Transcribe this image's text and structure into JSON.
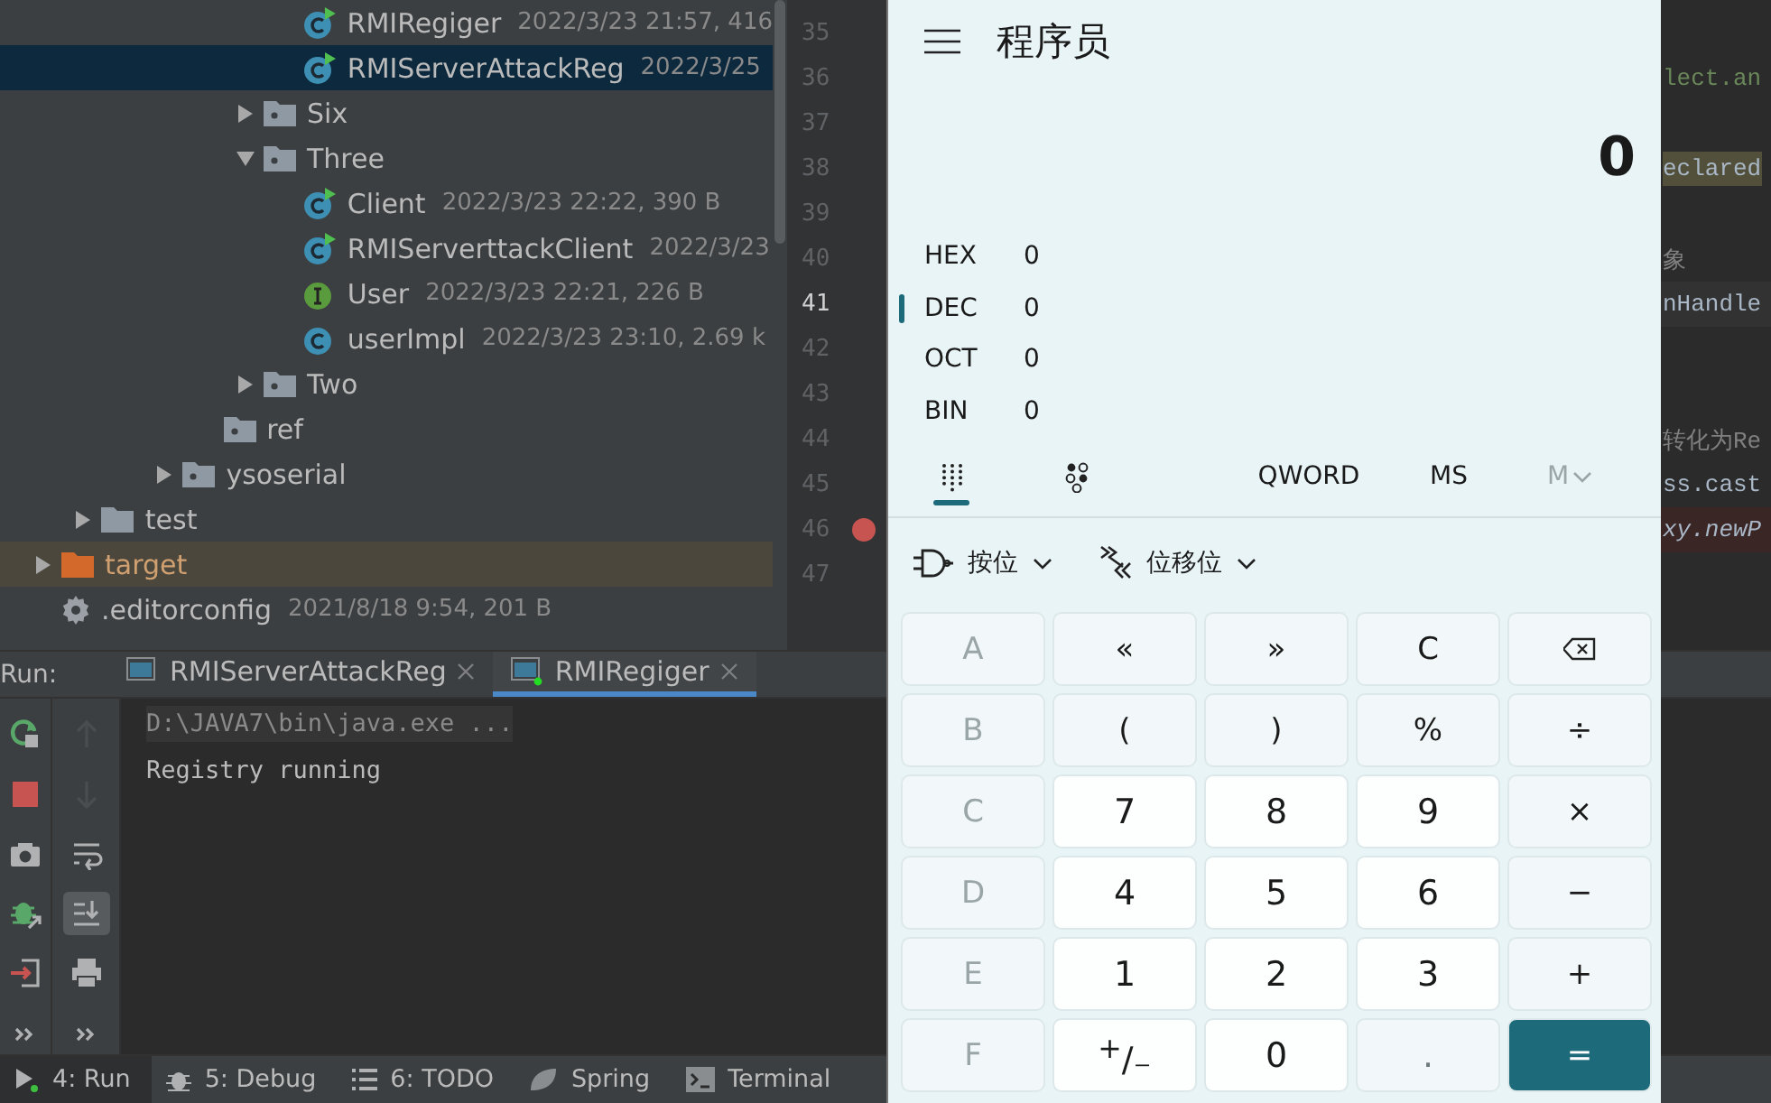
{
  "project_tree": {
    "items": [
      {
        "children": [
          {
            "children": [
              {
                "children": [
                  {
                    "children": [
                      {
                        "children": [
                          {
                            "children": [
                              {
                                "label": "RMIRegiger",
                                "meta": "2022/3/23 21:57, 416",
                                "kind": "class-run",
                                "selected": false
                              },
                              {
                                "label": "RMIServerAttackReg",
                                "meta": "2022/3/25",
                                "kind": "class-run",
                                "selected": true
                              }
                            ]
                          },
                          {
                            "label": "Six",
                            "kind": "package",
                            "expanded": false,
                            "selected": false
                          },
                          {
                            "label": "Three",
                            "kind": "package",
                            "expanded": true,
                            "selected": false,
                            "children": [
                              {
                                "label": "Client",
                                "meta": "2022/3/23 22:22, 390 B",
                                "kind": "class-run",
                                "selected": false
                              },
                              {
                                "label": "RMIServerttackClient",
                                "meta": "2022/3/23",
                                "kind": "class-run",
                                "selected": false
                              },
                              {
                                "label": "User",
                                "meta": "2022/3/23 22:21, 226 B",
                                "kind": "interface",
                                "selected": false
                              },
                              {
                                "label": "userImpl",
                                "meta": "2022/3/23 23:10, 2.69 k",
                                "kind": "class",
                                "selected": false
                              }
                            ]
                          },
                          {
                            "label": "Two",
                            "kind": "package",
                            "expanded": false,
                            "selected": false
                          }
                        ]
                      },
                      {
                        "label": "ref",
                        "kind": "package",
                        "selected": false
                      }
                    ]
                  },
                  {
                    "label": "ysoserial",
                    "kind": "package",
                    "expanded": false,
                    "selected": false
                  }
                ]
              }
            ]
          },
          {
            "label": "test",
            "kind": "folder",
            "expanded": false,
            "selected": false
          }
        ]
      },
      {
        "label": "target",
        "kind": "excluded-folder",
        "expanded": false,
        "selected": false
      },
      {
        "label": ".editorconfig",
        "meta": "2021/8/18 9:54, 201 B",
        "kind": "config",
        "selected": false
      }
    ]
  },
  "editor": {
    "lines": [
      {
        "number": "35",
        "current": false
      },
      {
        "number": "36",
        "current": false,
        "code": "lect.an",
        "kind": "string"
      },
      {
        "number": "37",
        "current": false
      },
      {
        "number": "38",
        "current": false,
        "code": "eclared",
        "kind": "highlight"
      },
      {
        "number": "39",
        "current": false
      },
      {
        "number": "40",
        "current": false,
        "code": "象",
        "kind": "comment"
      },
      {
        "number": "41",
        "current": true,
        "code": "nHandle",
        "kind": "plain"
      },
      {
        "number": "42",
        "current": false
      },
      {
        "number": "43",
        "current": false
      },
      {
        "number": "44",
        "current": false,
        "code": "转化为Re",
        "kind": "comment"
      },
      {
        "number": "45",
        "current": false,
        "code": "ss.cast",
        "kind": "plain"
      },
      {
        "number": "46",
        "current": false,
        "breakpoint": true,
        "code": "xy.newP",
        "kind": "italic"
      },
      {
        "number": "47",
        "current": false
      }
    ]
  },
  "run": {
    "title": "Run:",
    "tabs": [
      {
        "label": "RMIServerAttackReg",
        "selected": false,
        "running": false
      },
      {
        "label": "RMIRegiger",
        "selected": true,
        "running": true
      }
    ],
    "toolbar_left": [
      {
        "kind": "rerun"
      },
      {
        "kind": "stop"
      },
      {
        "kind": "camera"
      },
      {
        "kind": "debug"
      },
      {
        "kind": "exit"
      },
      {
        "kind": "more"
      }
    ],
    "toolbar_right": [
      {
        "kind": "up",
        "disabled": true
      },
      {
        "kind": "down",
        "disabled": true
      },
      {
        "kind": "wrap",
        "disabled": false
      },
      {
        "kind": "scroll-end",
        "disabled": false,
        "on": true
      },
      {
        "kind": "print",
        "disabled": false
      },
      {
        "kind": "more",
        "disabled": false
      }
    ],
    "console": [
      {
        "text": "D:\\JAVA7\\bin\\java.exe ...",
        "kind": "command"
      },
      {
        "text": "Registry running",
        "kind": "output"
      }
    ]
  },
  "tool_windows": [
    {
      "label": "4: Run",
      "kind": "run",
      "selected": true
    },
    {
      "label": "5: Debug",
      "kind": "debug",
      "selected": false
    },
    {
      "label": "6: TODO",
      "kind": "todo",
      "selected": false
    },
    {
      "label": "Spring",
      "kind": "spring",
      "selected": false
    },
    {
      "label": "Terminal",
      "kind": "terminal",
      "selected": false
    }
  ],
  "calculator": {
    "title": "程序员",
    "display": "0",
    "radix": [
      {
        "label": "HEX",
        "value": "0",
        "selected": false
      },
      {
        "label": "DEC",
        "value": "0",
        "selected": true
      },
      {
        "label": "OCT",
        "value": "0",
        "selected": false
      },
      {
        "label": "BIN",
        "value": "0",
        "selected": false
      }
    ],
    "modes": [
      {
        "kind": "keypad",
        "selected": true
      },
      {
        "kind": "bits",
        "selected": false
      }
    ],
    "word_size": "QWORD",
    "memory": [
      {
        "label": "MS",
        "disabled": false,
        "kind": "plain"
      },
      {
        "label": "M",
        "disabled": true,
        "kind": "dropdown"
      }
    ],
    "menus": [
      {
        "label": "按位",
        "kind": "bitwise"
      },
      {
        "label": "位移位",
        "kind": "shift"
      }
    ],
    "keys": [
      {
        "label": "A",
        "kind": "hex",
        "disabled": true
      },
      {
        "label": "«",
        "kind": "op",
        "disabled": false
      },
      {
        "label": "»",
        "kind": "op",
        "disabled": false
      },
      {
        "label": "C",
        "kind": "op",
        "disabled": false
      },
      {
        "kind": "backspace",
        "disabled": false
      },
      {
        "label": "B",
        "kind": "hex",
        "disabled": true
      },
      {
        "label": "(",
        "kind": "op",
        "disabled": false
      },
      {
        "label": ")",
        "kind": "op",
        "disabled": false
      },
      {
        "label": "%",
        "kind": "op",
        "disabled": false
      },
      {
        "label": "÷",
        "kind": "op",
        "disabled": false
      },
      {
        "label": "C",
        "kind": "hex",
        "disabled": true
      },
      {
        "label": "7",
        "kind": "digit",
        "disabled": false
      },
      {
        "label": "8",
        "kind": "digit",
        "disabled": false
      },
      {
        "label": "9",
        "kind": "digit",
        "disabled": false
      },
      {
        "label": "×",
        "kind": "op",
        "disabled": false
      },
      {
        "label": "D",
        "kind": "hex",
        "disabled": true
      },
      {
        "label": "4",
        "kind": "digit",
        "disabled": false
      },
      {
        "label": "5",
        "kind": "digit",
        "disabled": false
      },
      {
        "label": "6",
        "kind": "digit",
        "disabled": false
      },
      {
        "label": "−",
        "kind": "op",
        "disabled": false
      },
      {
        "label": "E",
        "kind": "hex",
        "disabled": true
      },
      {
        "label": "1",
        "kind": "digit",
        "disabled": false
      },
      {
        "label": "2",
        "kind": "digit",
        "disabled": false
      },
      {
        "label": "3",
        "kind": "digit",
        "disabled": false
      },
      {
        "label": "+",
        "kind": "op",
        "disabled": false
      },
      {
        "label": "F",
        "kind": "hex",
        "disabled": true
      },
      {
        "label": "$^{+}$/₋",
        "kind": "digit",
        "disabled": false
      },
      {
        "label": "0",
        "kind": "digit",
        "disabled": false
      },
      {
        "label": ".",
        "kind": "digit",
        "disabled": true
      },
      {
        "label": "=",
        "kind": "equals",
        "disabled": false
      }
    ]
  }
}
